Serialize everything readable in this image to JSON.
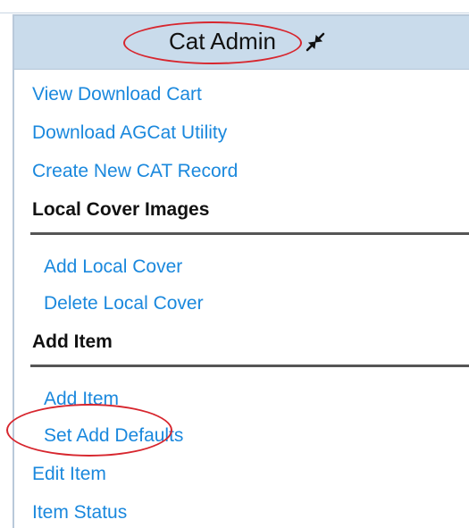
{
  "panel": {
    "title": "Cat Admin",
    "collapse_icon": "collapse-arrows-icon"
  },
  "menu": {
    "items": [
      {
        "type": "link",
        "label": "View Download Cart"
      },
      {
        "type": "link",
        "label": "Download AGCat Utility"
      },
      {
        "type": "link",
        "label": "Create New CAT Record"
      },
      {
        "type": "heading",
        "label": "Local Cover Images"
      },
      {
        "type": "link",
        "label": "Add Local Cover"
      },
      {
        "type": "link",
        "label": "Delete Local Cover"
      },
      {
        "type": "heading",
        "label": "Add Item"
      },
      {
        "type": "link",
        "label": "Add Item"
      },
      {
        "type": "link",
        "label": "Set Add Defaults"
      },
      {
        "type": "link",
        "label": "Edit Item"
      },
      {
        "type": "link",
        "label": "Item Status"
      }
    ]
  },
  "colors": {
    "header_bg": "#c9dbeb",
    "link": "#1a88dd",
    "annotation": "#d7262e"
  }
}
